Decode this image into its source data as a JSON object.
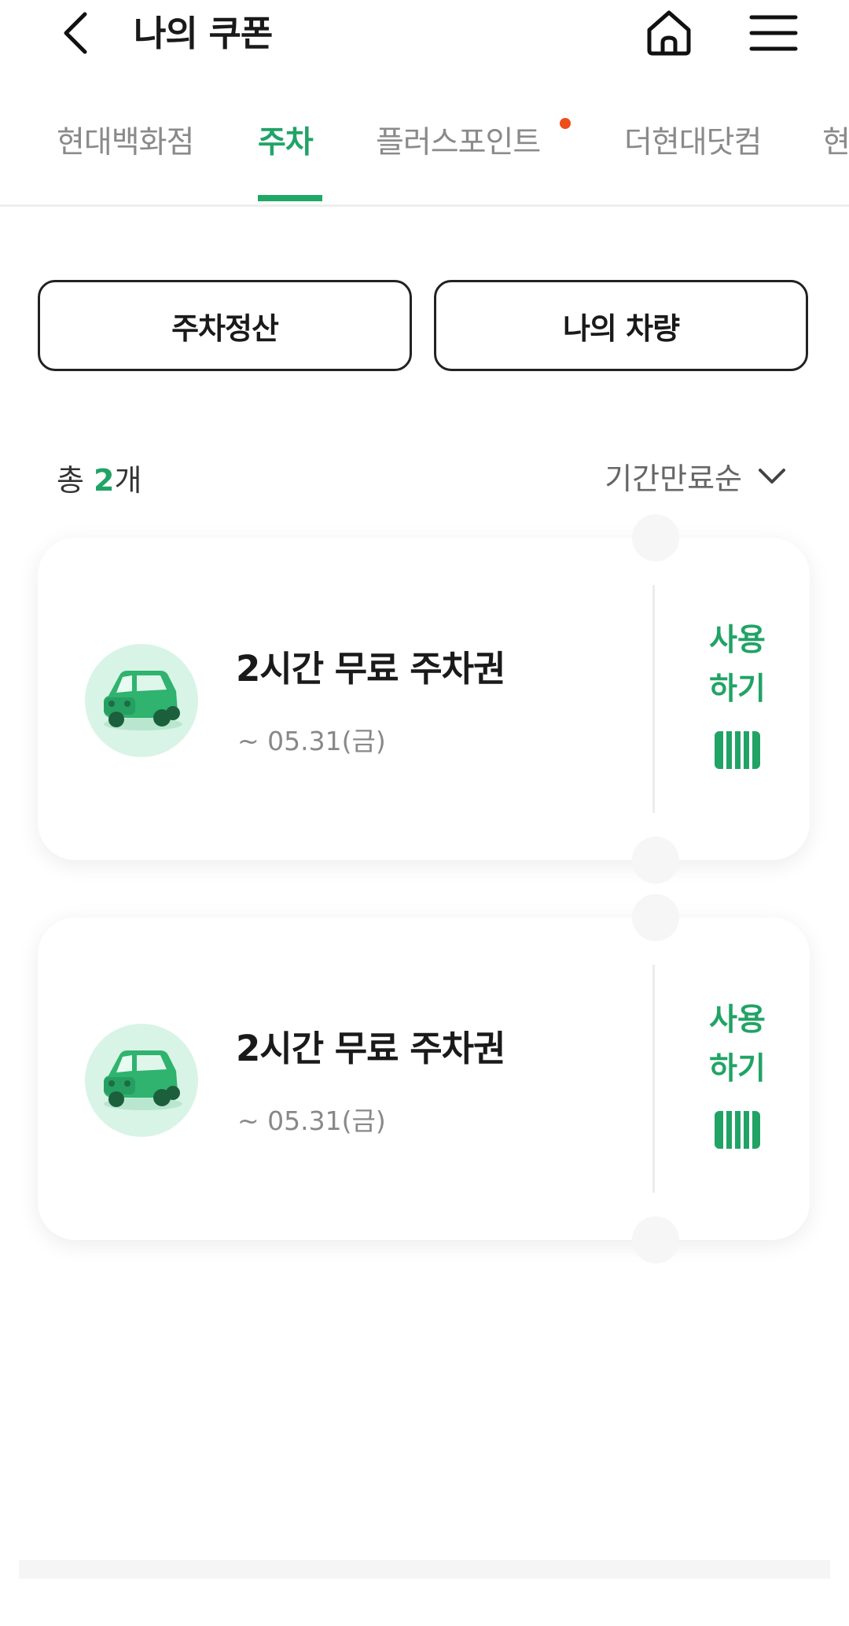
{
  "header": {
    "title": "나의 쿠폰"
  },
  "tabs": [
    {
      "label": "현대백화점",
      "active": false
    },
    {
      "label": "주차",
      "active": true
    },
    {
      "label": "플러스포인트",
      "active": false,
      "has_new_dot": true
    },
    {
      "label": "더현대닷컴",
      "active": false
    },
    {
      "label": "현",
      "active": false
    }
  ],
  "actions": {
    "parking_pay": "주차정산",
    "my_vehicle": "나의 차량"
  },
  "summary": {
    "total_prefix": "총 ",
    "total_count": "2",
    "total_suffix": "개",
    "sort_label": "기간만료순"
  },
  "coupons": [
    {
      "title": "2시간 무료 주차권",
      "expiry": "~ 05.31(금)",
      "use_line1": "사용",
      "use_line2": "하기"
    },
    {
      "title": "2시간 무료 주차권",
      "expiry": "~ 05.31(금)",
      "use_line1": "사용",
      "use_line2": "하기"
    }
  ],
  "colors": {
    "accent": "#21a366",
    "dot": "#ee4d1c",
    "car_bg": "#d8f4e6"
  },
  "icons": [
    "back-arrow-icon",
    "home-icon",
    "hamburger-menu-icon",
    "chevron-down-icon",
    "car-icon",
    "barcode-icon"
  ]
}
